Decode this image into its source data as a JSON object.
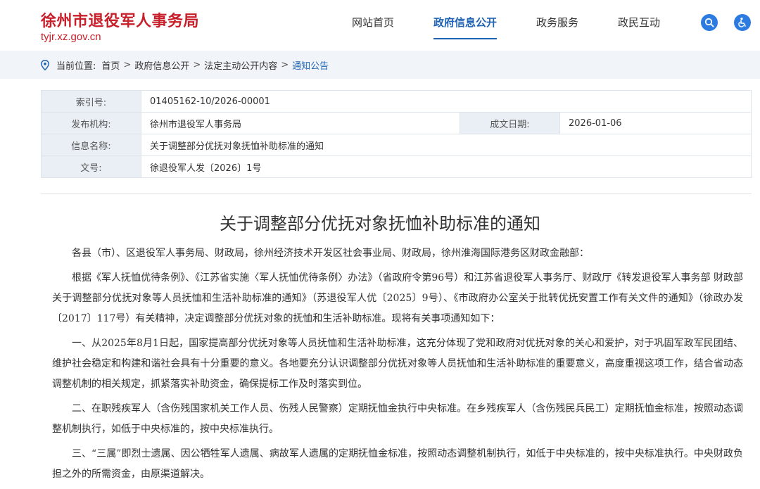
{
  "header": {
    "site_name": "徐州市退役军人事务局",
    "site_url": "tyjr.xz.gov.cn",
    "nav": [
      {
        "label": "网站首页",
        "active": false
      },
      {
        "label": "政府信息公开",
        "active": true
      },
      {
        "label": "政务服务",
        "active": false
      },
      {
        "label": "政民互动",
        "active": false
      }
    ],
    "icons": [
      "search-icon",
      "accessibility-icon"
    ]
  },
  "breadcrumb": {
    "prefix": "当前位置:",
    "items": [
      "首页",
      "政府信息公开",
      "法定主动公开内容",
      "通知公告"
    ],
    "separator": ">"
  },
  "meta": {
    "index_label": "索引号:",
    "index_value": "01405162-10/2026-00001",
    "publisher_label": "发布机构:",
    "publisher_value": "徐州市退役军人事务局",
    "date_label": "成文日期:",
    "date_value": "2026-01-06",
    "name_label": "信息名称:",
    "name_value": "关于调整部分优抚对象抚恤补助标准的通知",
    "docno_label": "文号:",
    "docno_value": "徐退役军人发〔2026〕1号"
  },
  "document": {
    "title": "关于调整部分优抚对象抚恤补助标准的通知",
    "paragraphs": [
      "各县（市）、区退役军人事务局、财政局，徐州经济技术开发区社会事业局、财政局，徐州淮海国际港务区财政金融部：",
      "根据《军人抚恤优待条例》、《江苏省实施〈军人抚恤优待条例〉办法》（省政府令第96号）和江苏省退役军人事务厅、财政厅《转发退役军人事务部 财政部关于调整部分优抚对象等人员抚恤和生活补助标准的通知》（苏退役军人优〔2025〕9号）、《市政府办公室关于批转优抚安置工作有关文件的通知》（徐政办发〔2017〕117号）有关精神，决定调整部分优抚对象的抚恤和生活补助标准。现将有关事项通知如下：",
      "一、从2025年8月1日起，国家提高部分优抚对象等人员抚恤和生活补助标准，这充分体现了党和政府对优抚对象的关心和爱护，对于巩固军政军民团结、维护社会稳定和构建和谐社会具有十分重要的意义。各地要充分认识调整部分优抚对象等人员抚恤和生活补助标准的重要意义，高度重视这项工作，结合省动态调整机制的相关规定，抓紧落实补助资金，确保提标工作及时落实到位。",
      "二、在职残疾军人（含伤残国家机关工作人员、伤残人民警察）定期抚恤金执行中央标准。在乡残疾军人（含伤残民兵民工）定期抚恤金标准，按照动态调整机制执行，如低于中央标准的，按中央标准执行。",
      "三、“三属”即烈士遗属、因公牺牲军人遗属、病故军人遗属的定期抚恤金标准，按照动态调整机制执行，如低于中央标准的，按中央标准执行。中央财政负担之外的所需资金，由原渠道解决。"
    ]
  },
  "colors": {
    "brand_red": "#c8202a",
    "accent_blue": "#1f63b3",
    "icon_blue": "#2c7be0",
    "breadcrumb_bg": "#f1f4f8",
    "label_bg": "#eaeff5"
  }
}
